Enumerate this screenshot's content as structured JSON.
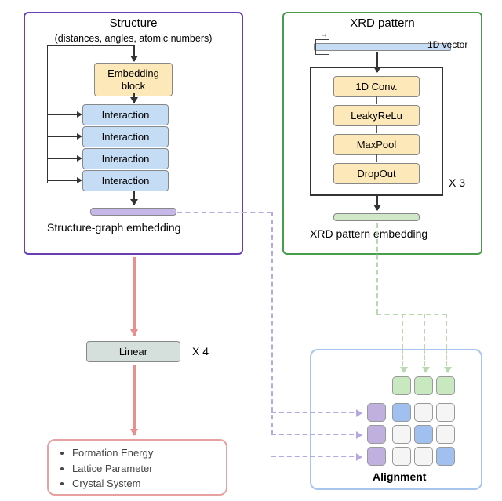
{
  "structure": {
    "title": "Structure",
    "subtitle": "(distances, angles, atomic numbers)",
    "embedding": "Embedding\nblock",
    "interactions": [
      "Interaction",
      "Interaction",
      "Interaction",
      "Interaction"
    ],
    "out_label": "Structure-graph embedding"
  },
  "xrd": {
    "title": "XRD pattern",
    "vector_label": "1D vector",
    "conv_layers": [
      "1D Conv.",
      "LeakyReLu",
      "MaxPool",
      "DropOut"
    ],
    "repeat": "X 3",
    "out_label": "XRD pattern embedding"
  },
  "linear": {
    "label": "Linear",
    "repeat": "X 4"
  },
  "outputs": {
    "items": [
      "Formation Energy",
      "Lattice Parameter",
      "Crystal System"
    ]
  },
  "alignment": {
    "label": "Alignment"
  }
}
